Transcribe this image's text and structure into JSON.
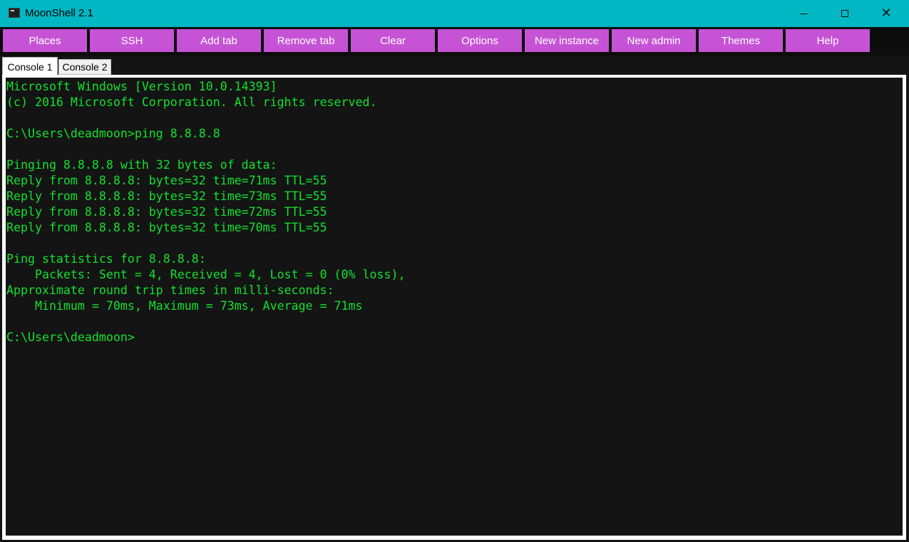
{
  "window": {
    "title": "MoonShell 2.1",
    "icon": "terminal-icon",
    "controls": {
      "minimize": "minimize-icon",
      "maximize": "maximize-icon",
      "close": "close-icon"
    }
  },
  "toolbar": {
    "buttons": [
      {
        "label": "Places"
      },
      {
        "label": "SSH"
      },
      {
        "label": "Add tab"
      },
      {
        "label": "Remove tab"
      },
      {
        "label": "Clear"
      },
      {
        "label": "Options"
      },
      {
        "label": "New instance"
      },
      {
        "label": "New admin"
      },
      {
        "label": "Themes"
      },
      {
        "label": "Help"
      }
    ]
  },
  "tabs": [
    {
      "label": "Console 1",
      "active": true
    },
    {
      "label": "Console 2",
      "active": false
    }
  ],
  "console": {
    "lines": [
      "Microsoft Windows [Version 10.0.14393]",
      "(c) 2016 Microsoft Corporation. All rights reserved.",
      "",
      "C:\\Users\\deadmoon>ping 8.8.8.8",
      "",
      "Pinging 8.8.8.8 with 32 bytes of data:",
      "Reply from 8.8.8.8: bytes=32 time=71ms TTL=55",
      "Reply from 8.8.8.8: bytes=32 time=73ms TTL=55",
      "Reply from 8.8.8.8: bytes=32 time=72ms TTL=55",
      "Reply from 8.8.8.8: bytes=32 time=70ms TTL=55",
      "",
      "Ping statistics for 8.8.8.8:",
      "    Packets: Sent = 4, Received = 4, Lost = 0 (0% loss),",
      "Approximate round trip times in milli-seconds:",
      "    Minimum = 70ms, Maximum = 73ms, Average = 71ms",
      "",
      "C:\\Users\\deadmoon>"
    ]
  },
  "colors": {
    "titlebar": "#00b7c3",
    "toolbar_button": "#c653d6",
    "console_background": "#141414",
    "console_text": "#12e12e"
  }
}
